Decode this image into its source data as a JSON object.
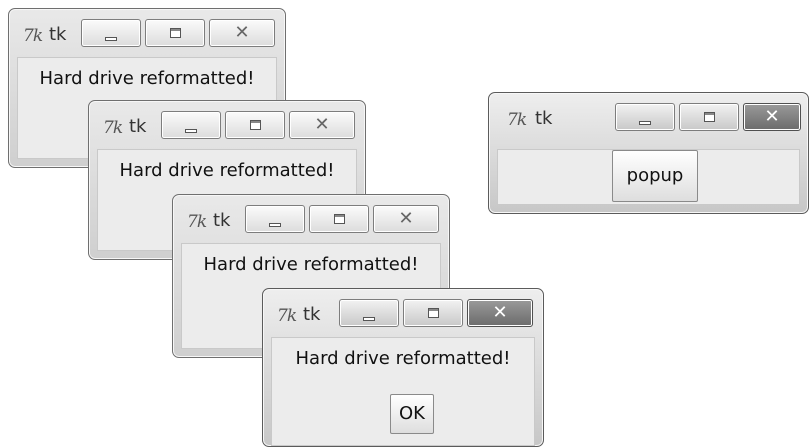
{
  "popups": [
    {
      "icon": "tk-feather-icon",
      "title": "tk",
      "message": "Hard drive reformatted!",
      "close_glyph": "✕"
    },
    {
      "icon": "tk-feather-icon",
      "title": "tk",
      "message": "Hard drive reformatted!",
      "close_glyph": "✕"
    },
    {
      "icon": "tk-feather-icon",
      "title": "tk",
      "message": "Hard drive reformatted!",
      "close_glyph": "✕"
    },
    {
      "icon": "tk-feather-icon",
      "title": "tk",
      "message": "Hard drive reformatted!",
      "close_glyph": "✕",
      "ok_label": "OK"
    }
  ],
  "main_window": {
    "icon": "tk-feather-icon",
    "title": "tk",
    "button_label": "popup",
    "close_glyph": "✕"
  },
  "tk_logo_text": "7k"
}
